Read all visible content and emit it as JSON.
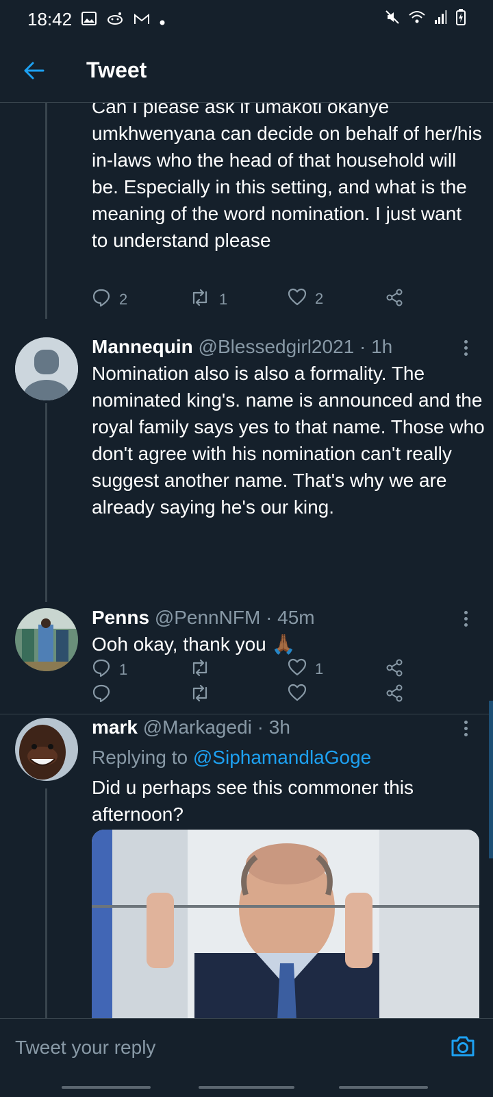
{
  "status_bar": {
    "time": "18:42",
    "notification_icons": [
      "image-icon",
      "reddit-icon",
      "gmail-icon",
      "dot-icon"
    ],
    "system_icons": [
      "mute-icon",
      "wifi-icon",
      "signal-icon",
      "battery-charging-icon"
    ]
  },
  "header": {
    "title": "Tweet",
    "back_icon": "arrow-left-icon"
  },
  "tweets": [
    {
      "text": "Can I please ask if umakoti okanye umkhwenyana can decide on behalf of her/his in-laws who the head of that household will be. Especially in this setting, and what is the meaning of the word nomination. I just want to understand please",
      "replies": "2",
      "retweets": "1",
      "likes": "2"
    },
    {
      "name": "Mannequin",
      "handle": "@Blessedgirl2021",
      "time": "· 1h",
      "text": "Nomination also is also a formality. The nominated king's. name is announced and the royal family says yes to that name. Those who don't agree with his nomination can't  really suggest another name. That's why we are already saying he's our king.",
      "replies": "1",
      "retweets": "",
      "likes": "1"
    },
    {
      "name": "Penns",
      "handle": "@PennNFM",
      "time": "· 45m",
      "text": "Ooh okay, thank you",
      "emoji": "🙏🏾",
      "replies": "",
      "retweets": "",
      "likes": ""
    },
    {
      "name": "mark",
      "handle": "@Markagedi",
      "time": "· 3h",
      "replying_label": "Replying to",
      "replying_to": "@SiphamandlaGoge",
      "text": "Did u perhaps see this commoner this afternoon?"
    }
  ],
  "reply_bar": {
    "placeholder": "Tweet your reply"
  },
  "colors": {
    "background": "#15202b",
    "accent": "#1da1f2",
    "muted": "#8899a6",
    "divider": "#38444d"
  }
}
